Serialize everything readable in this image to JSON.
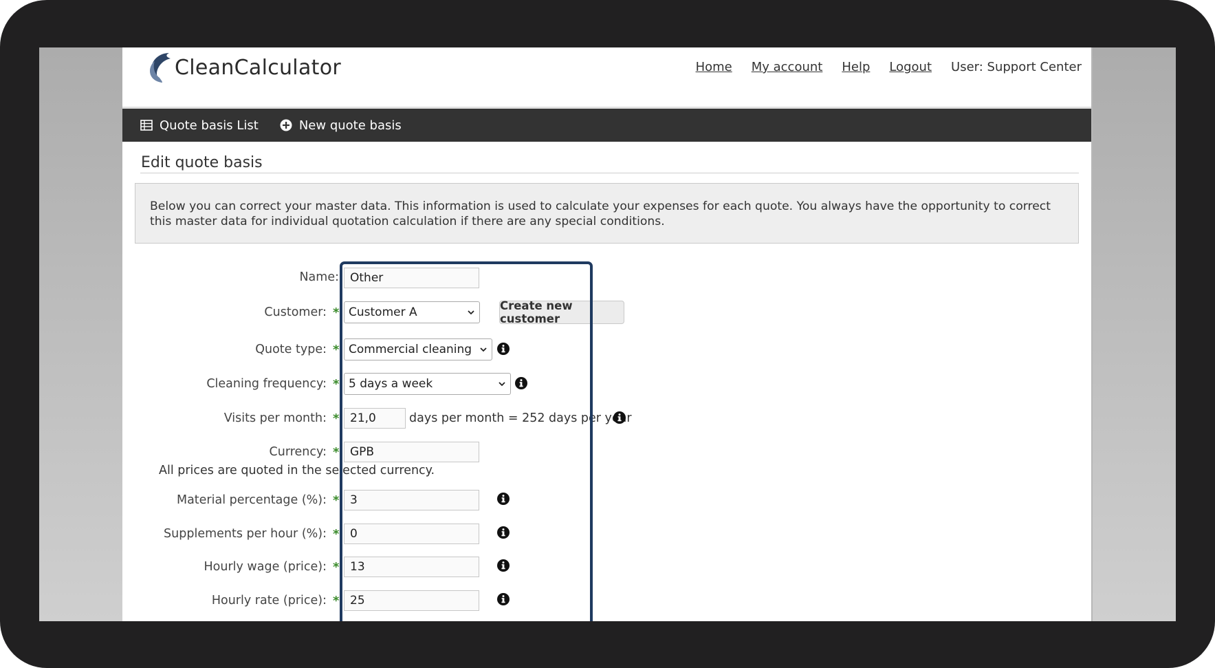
{
  "app": {
    "logo_text": "CleanCalculator"
  },
  "topnav": {
    "home": "Home",
    "my_account": "My account",
    "help": "Help",
    "logout": "Logout",
    "user": "User: Support Center"
  },
  "toolbar": {
    "list_label": "Quote basis List",
    "new_label": "New quote basis"
  },
  "page": {
    "title": "Edit quote basis",
    "info_text": "Below you can correct your master data. This information is used to calculate your expenses for each quote. You always have the opportunity to correct this master data for individual quotation calculation if there are any special conditions."
  },
  "form": {
    "name": {
      "label": "Name:",
      "value": "Other"
    },
    "customer": {
      "label": "Customer:",
      "value": "Customer A",
      "create_button": "Create new customer"
    },
    "quote_type": {
      "label": "Quote type:",
      "value": "Commercial cleaning"
    },
    "frequency": {
      "label": "Cleaning frequency:",
      "value": "5 days a week"
    },
    "visits": {
      "label": "Visits per month:",
      "value": "21,0",
      "suffix": "days per month = 252 days per year"
    },
    "currency": {
      "label": "Currency:",
      "value": "GPB",
      "note": "All prices are quoted in the selected currency."
    },
    "material": {
      "label": "Material percentage (%):",
      "value": "3"
    },
    "supplements": {
      "label": "Supplements per hour (%):",
      "value": "0"
    },
    "wage": {
      "label": "Hourly wage (price):",
      "value": "13"
    },
    "rate": {
      "label": "Hourly rate (price):",
      "value": "25"
    },
    "required_mark": "*"
  },
  "colors": {
    "toolbar_bg": "#333333",
    "highlight_border": "#1f3a60",
    "required_star": "#3b8b2c"
  }
}
